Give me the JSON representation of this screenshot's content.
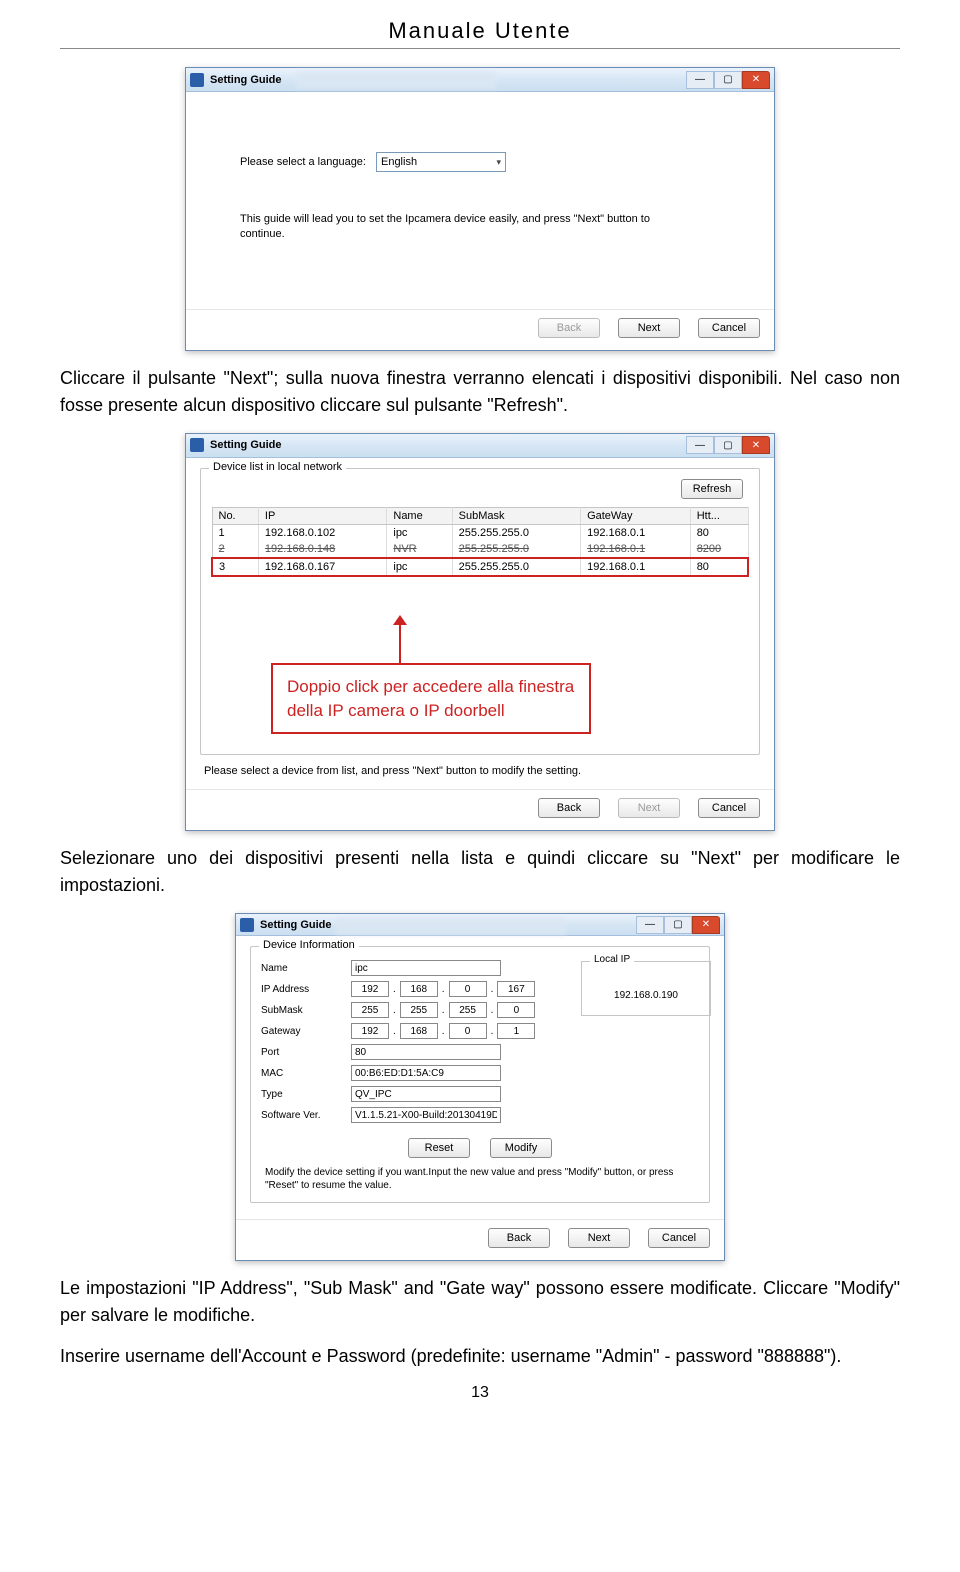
{
  "doc": {
    "title": "Manuale Utente",
    "para1": "Cliccare il pulsante \"Next\"; sulla nuova finestra verranno elencati i dispositivi disponibili. Nel caso non fosse presente alcun dispositivo cliccare sul pulsante \"Refresh\".",
    "para2": "Selezionare uno dei dispositivi presenti nella lista e quindi cliccare su \"Next\" per modificare le impostazioni.",
    "para3": "Le impostazioni \"IP Address\", \"Sub Mask\" and \"Gate way\" possono essere modificate. Cliccare \"Modify\" per salvare le modifiche.",
    "para4": "Inserire username dell'Account e Password (predefinite: username \"Admin\" - password \"888888\").",
    "page": "13",
    "annot": "Doppio click per accedere alla finestra della IP camera o IP doorbell"
  },
  "win1": {
    "title": "Setting Guide",
    "lang_label": "Please select a language:",
    "lang_value": "English",
    "note": "This guide will lead you to set the Ipcamera device easily, and press \"Next\" button to continue.",
    "btn_back": "Back",
    "btn_next": "Next",
    "btn_cancel": "Cancel"
  },
  "win2": {
    "title": "Setting Guide",
    "legend": "Device list in local network",
    "refresh": "Refresh",
    "cols": {
      "c0": "No.",
      "c1": "IP",
      "c2": "Name",
      "c3": "SubMask",
      "c4": "GateWay",
      "c5": "Htt..."
    },
    "rows": {
      "r0": {
        "no": "1",
        "ip": "192.168.0.102",
        "name": "ipc",
        "sub": "255.255.255.0",
        "gw": "192.168.0.1",
        "port": "80"
      },
      "r1": {
        "no": "2",
        "ip": "192.168.0.148",
        "name": "NVR",
        "sub": "255.255.255.0",
        "gw": "192.168.0.1",
        "port": "8200"
      },
      "r2": {
        "no": "3",
        "ip": "192.168.0.167",
        "name": "ipc",
        "sub": "255.255.255.0",
        "gw": "192.168.0.1",
        "port": "80"
      }
    },
    "note": "Please select a device from list, and press \"Next\" button to modify the setting.",
    "btn_back": "Back",
    "btn_next": "Next",
    "btn_cancel": "Cancel"
  },
  "win3": {
    "title": "Setting Guide",
    "legend": "Device Information",
    "labels": {
      "name": "Name",
      "ip": "IP Address",
      "sub": "SubMask",
      "gw": "Gateway",
      "port": "Port",
      "mac": "MAC",
      "type": "Type",
      "ver": "Software Ver."
    },
    "vals": {
      "name": "ipc",
      "ip": [
        "192",
        "168",
        "0",
        "167"
      ],
      "sub": [
        "255",
        "255",
        "255",
        "0"
      ],
      "gw": [
        "192",
        "168",
        "0",
        "1"
      ],
      "port": "80",
      "mac": "00:B6:ED:D1:5A:C9",
      "type": "QV_IPC",
      "ver": "V1.1.5.21-X00-Build:20130419D"
    },
    "local_legend": "Local IP",
    "local_ip": "192.168.0.190",
    "btn_reset": "Reset",
    "btn_modify": "Modify",
    "note": "Modify the device setting if you want.Input the new value and press \"Modify\"        button, or press \"Reset\" to resume the value.",
    "btn_back": "Back",
    "btn_next": "Next",
    "btn_cancel": "Cancel"
  }
}
